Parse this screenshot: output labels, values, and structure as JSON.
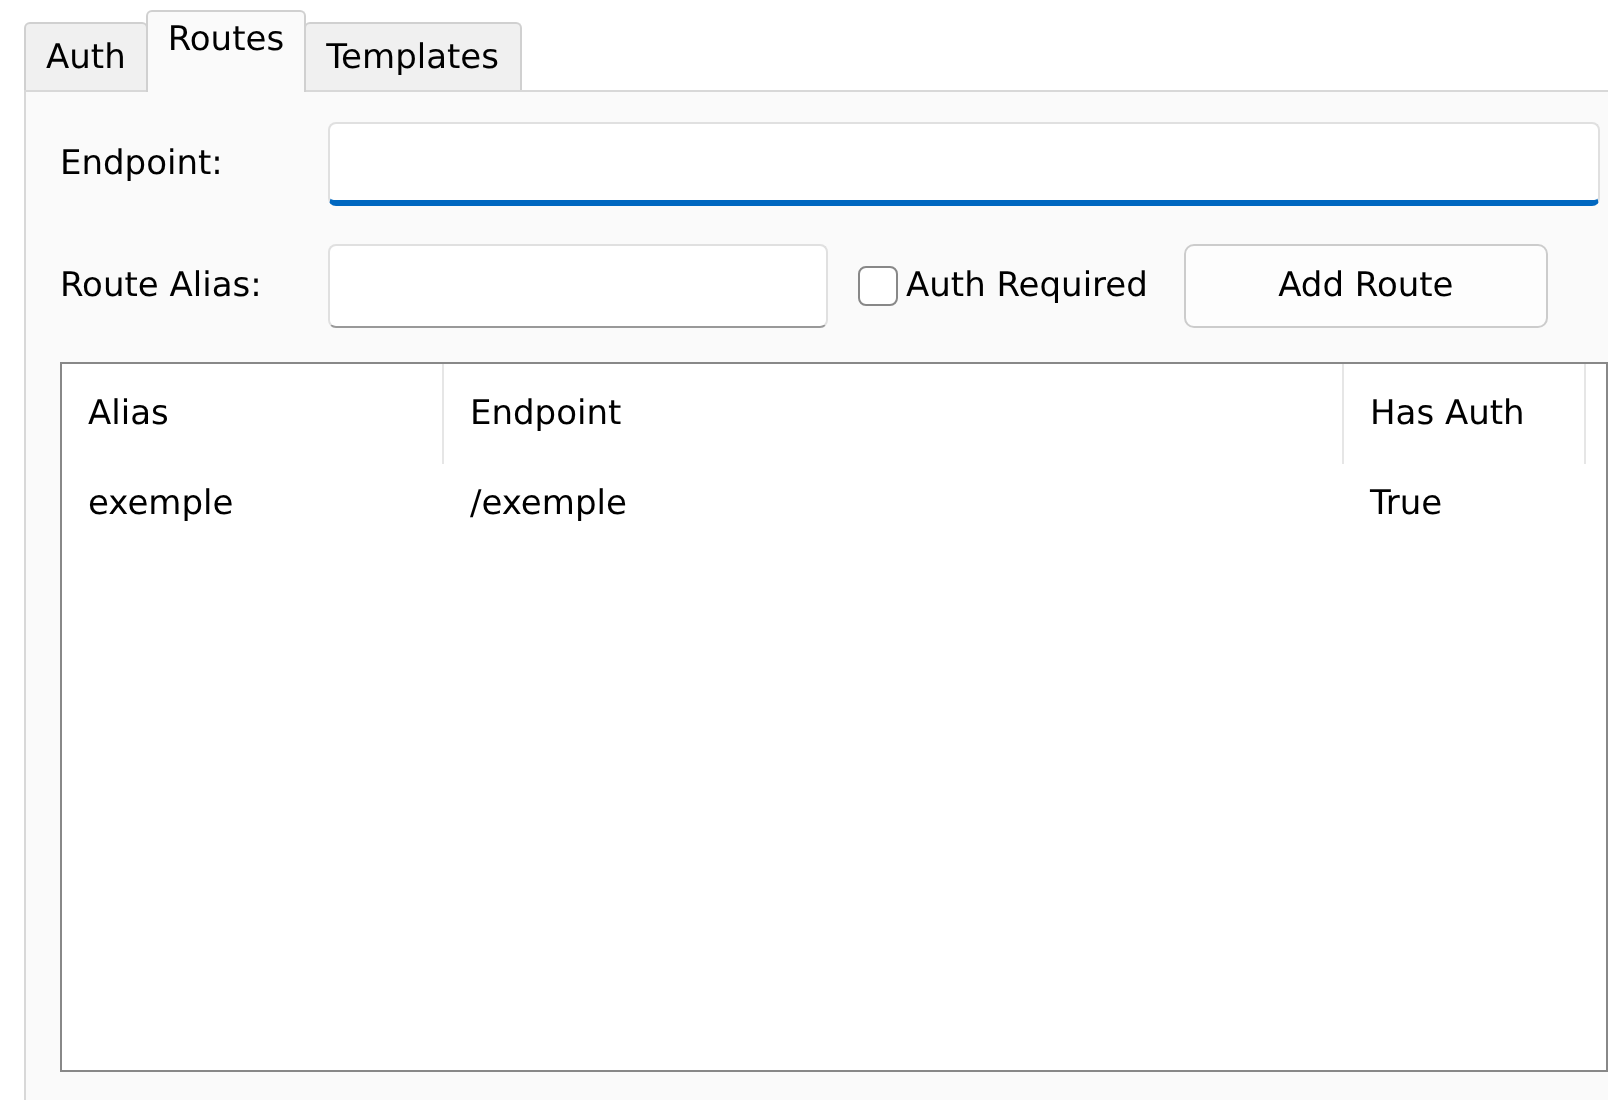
{
  "tabs": [
    {
      "label": "Auth",
      "selected": false
    },
    {
      "label": "Routes",
      "selected": true
    },
    {
      "label": "Templates",
      "selected": false
    }
  ],
  "endpoint": {
    "label": "Endpoint:",
    "focused": true
  },
  "route_alias": {
    "label": "Route Alias:",
    "focused": false
  },
  "auth_required": {
    "label": "Auth Required",
    "checked": false
  },
  "add_button": {
    "label": "Add Route"
  },
  "table": {
    "columns": [
      "Alias",
      "Endpoint",
      "Has Auth"
    ],
    "rows": [
      [
        "exemple",
        "/exemple",
        "True"
      ]
    ]
  }
}
